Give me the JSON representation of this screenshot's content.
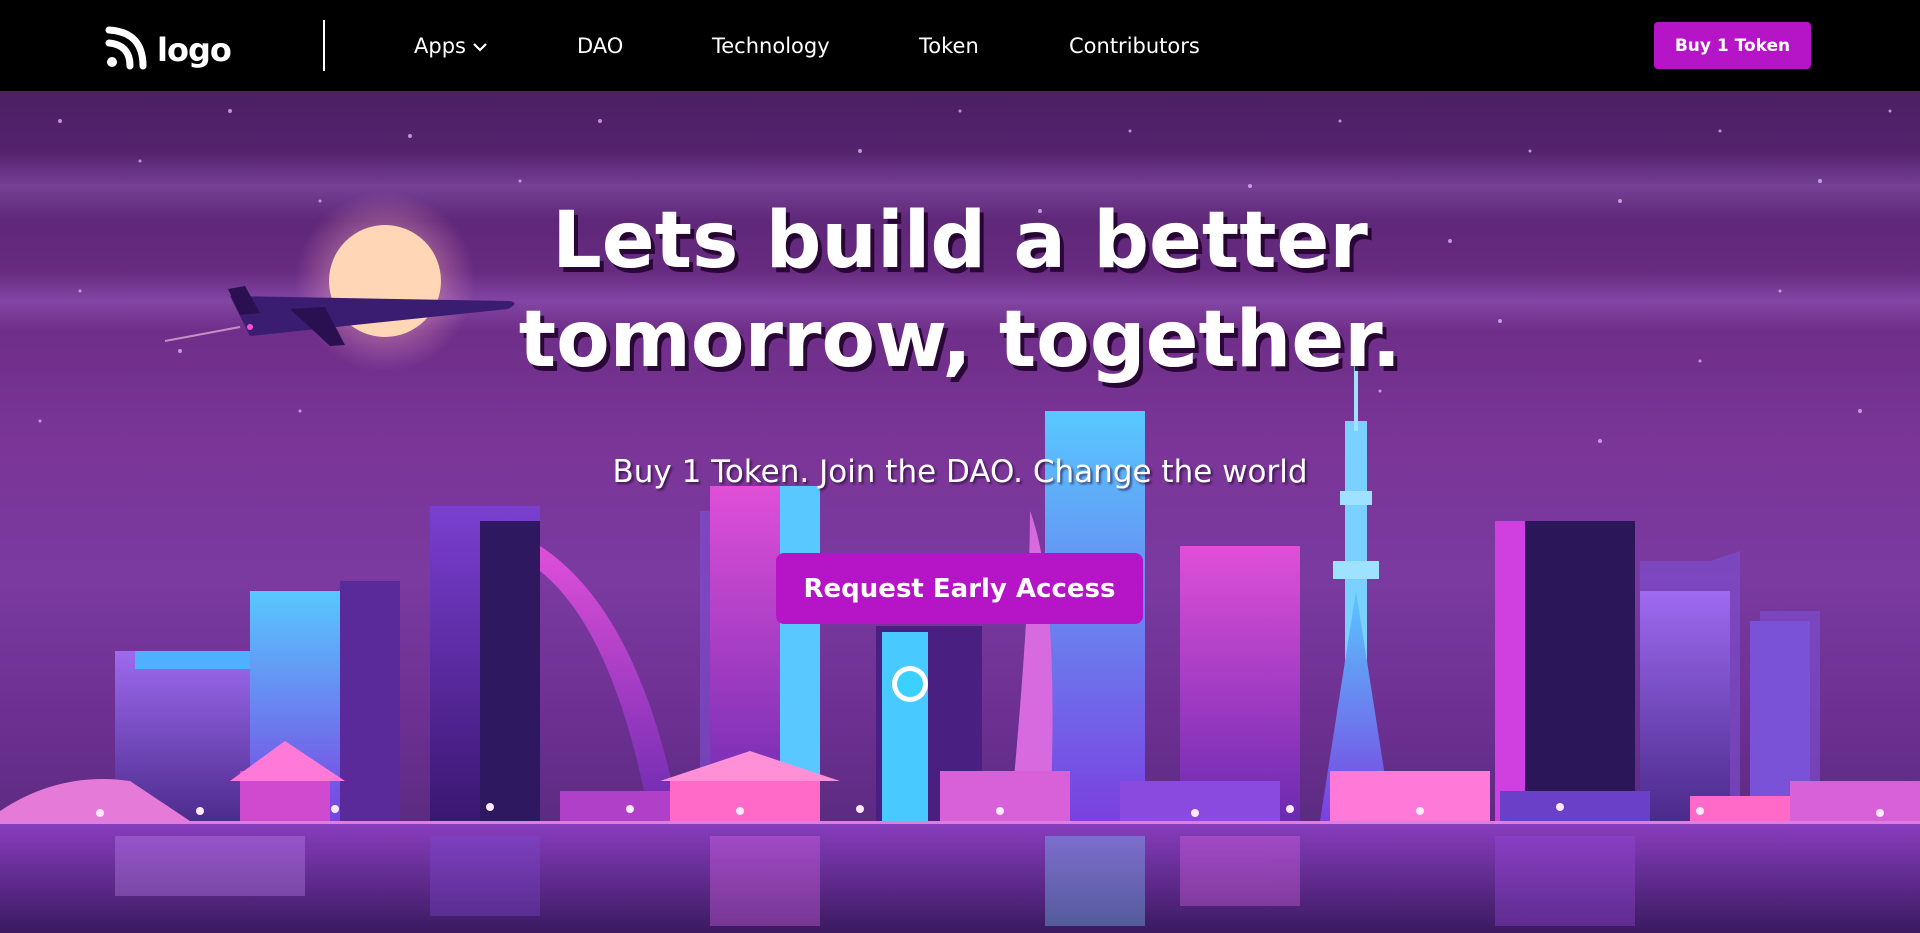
{
  "header": {
    "logo": {
      "icon": "signal-waves-icon",
      "text": "logo"
    },
    "nav": [
      {
        "label": "Apps",
        "has_dropdown": true,
        "icon": "chevron-down-icon"
      },
      {
        "label": "DAO"
      },
      {
        "label": "Technology"
      },
      {
        "label": "Token"
      },
      {
        "label": "Contributors"
      }
    ],
    "cta_label": "Buy 1 Token"
  },
  "hero": {
    "title_line1": "Lets build a better",
    "title_line2": "tomorrow, together.",
    "subtitle": "Buy 1 Token. Join the DAO. Change the world",
    "cta_label": "Request Early Access",
    "background": "neon city skyline at night with moon and airplane"
  },
  "colors": {
    "accent": "#b514c7",
    "nav_background": "#000000",
    "text": "#ffffff"
  }
}
